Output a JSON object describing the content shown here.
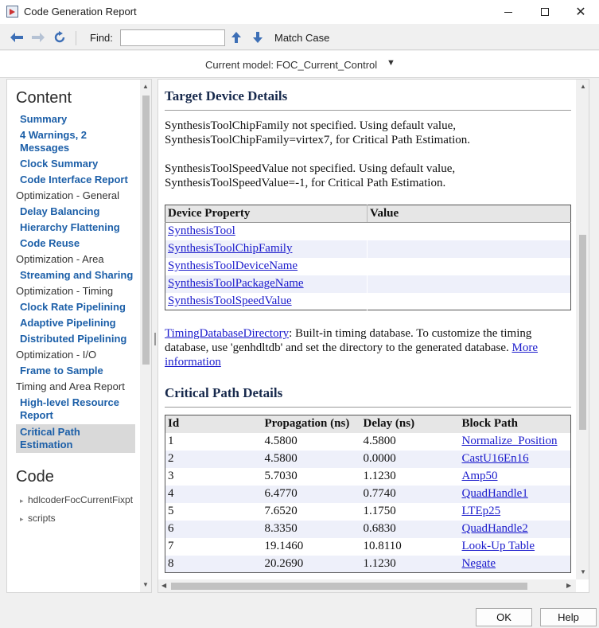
{
  "window": {
    "title": "Code Generation Report",
    "icon": "matlab-report-icon"
  },
  "toolbar": {
    "find_label": "Find:",
    "find_value": "",
    "match_case_label": "Match Case"
  },
  "model": {
    "label": "Current model:",
    "value": "FOC_Current_Control",
    "caret": "▼"
  },
  "sidebar": {
    "content_heading": "Content",
    "items": [
      {
        "label": "Summary",
        "type": "link"
      },
      {
        "label": "4 Warnings, 2 Messages",
        "type": "link"
      },
      {
        "label": "Clock Summary",
        "type": "link"
      },
      {
        "label": "Code Interface Report",
        "type": "link"
      },
      {
        "label": "Optimization - General",
        "type": "section"
      },
      {
        "label": "Delay Balancing",
        "type": "link"
      },
      {
        "label": "Hierarchy Flattening",
        "type": "link"
      },
      {
        "label": "Code Reuse",
        "type": "link"
      },
      {
        "label": "Optimization - Area",
        "type": "section"
      },
      {
        "label": "Streaming and Sharing",
        "type": "link"
      },
      {
        "label": "Optimization - Timing",
        "type": "section"
      },
      {
        "label": "Clock Rate Pipelining",
        "type": "link"
      },
      {
        "label": "Adaptive Pipelining",
        "type": "link"
      },
      {
        "label": "Distributed Pipelining",
        "type": "link"
      },
      {
        "label": "Optimization - I/O",
        "type": "section"
      },
      {
        "label": "Frame to Sample",
        "type": "link"
      },
      {
        "label": "Timing and Area Report",
        "type": "section"
      },
      {
        "label": "High-level Resource Report",
        "type": "link"
      },
      {
        "label": "Critical Path Estimation",
        "type": "link",
        "selected": true
      }
    ],
    "code_heading": "Code",
    "code_items": [
      "hdlcoderFocCurrentFixpt",
      "scripts"
    ]
  },
  "main": {
    "target_heading": "Target Device Details",
    "para1_line1": "SynthesisToolChipFamily not specified. Using default value,",
    "para1_line2": "SynthesisToolChipFamily=virtex7, for Critical Path Estimation.",
    "para2_line1": "SynthesisToolSpeedValue not specified. Using default value,",
    "para2_line2": "SynthesisToolSpeedValue=-1, for Critical Path Estimation.",
    "device_table": {
      "headers": [
        "Device Property",
        "Value"
      ],
      "rows": [
        {
          "property": "SynthesisTool",
          "value": ""
        },
        {
          "property": "SynthesisToolChipFamily",
          "value": ""
        },
        {
          "property": "SynthesisToolDeviceName",
          "value": ""
        },
        {
          "property": "SynthesisToolPackageName",
          "value": ""
        },
        {
          "property": "SynthesisToolSpeedValue",
          "value": ""
        }
      ]
    },
    "timing_db_link": "TimingDatabaseDirectory",
    "timing_db_text1": ": Built-in timing database. To customize the timing",
    "timing_db_text2": "database, use 'genhdltdb' and set the directory to the generated database.",
    "more_link": "More",
    "information_link": "information",
    "critical_heading": "Critical Path Details",
    "critical_table": {
      "headers": [
        "Id",
        "Propagation (ns)",
        "Delay (ns)",
        "Block Path"
      ],
      "rows": [
        {
          "id": "1",
          "prop": "4.5800",
          "delay": "4.5800",
          "path": "Normalize_Position"
        },
        {
          "id": "2",
          "prop": "4.5800",
          "delay": "0.0000",
          "path": "CastU16En16"
        },
        {
          "id": "3",
          "prop": "5.7030",
          "delay": "1.1230",
          "path": "Amp50"
        },
        {
          "id": "4",
          "prop": "6.4770",
          "delay": "0.7740",
          "path": "QuadHandle1"
        },
        {
          "id": "5",
          "prop": "7.6520",
          "delay": "1.1750",
          "path": "LTEp25"
        },
        {
          "id": "6",
          "prop": "8.3350",
          "delay": "0.6830",
          "path": "QuadHandle2"
        },
        {
          "id": "7",
          "prop": "19.1460",
          "delay": "10.8110",
          "path": "Look-Up Table"
        },
        {
          "id": "8",
          "prop": "20.2690",
          "delay": "1.1230",
          "path": "Negate"
        }
      ]
    }
  },
  "buttons": {
    "ok": "OK",
    "help": "Help"
  }
}
